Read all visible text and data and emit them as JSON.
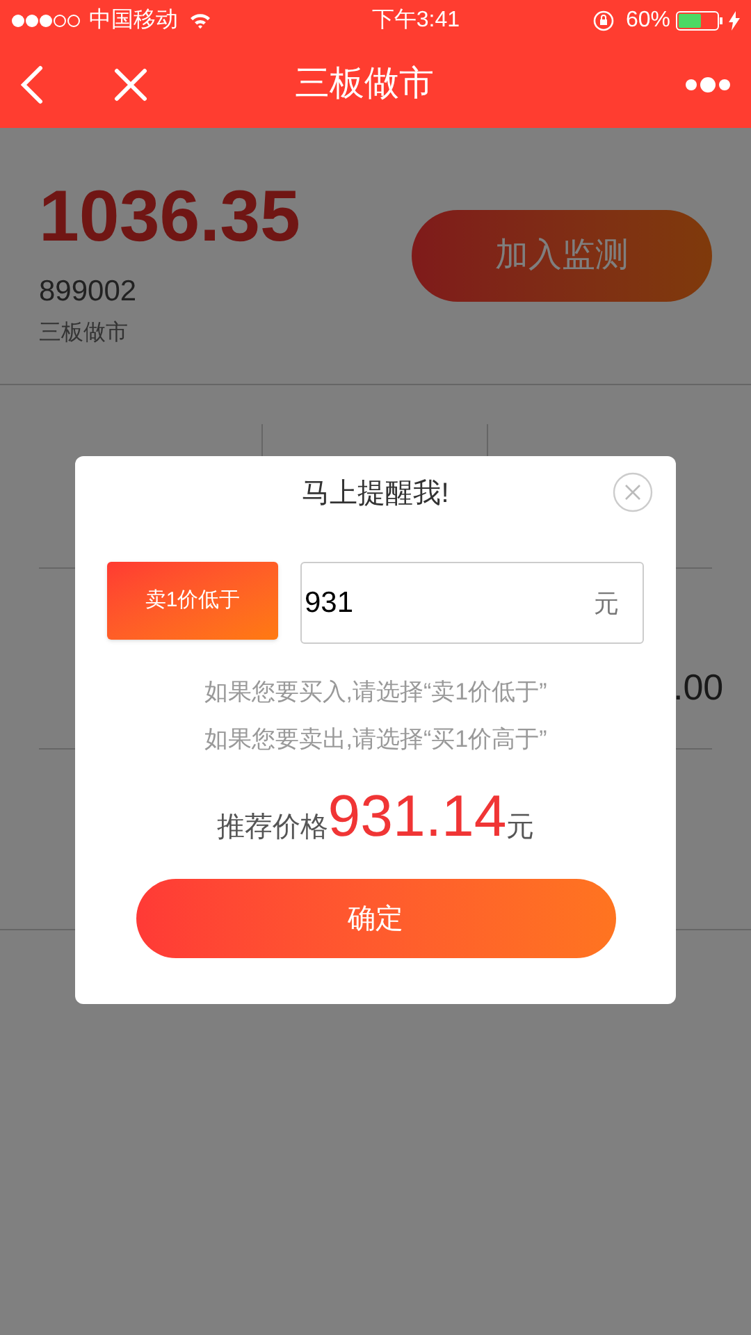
{
  "status_bar": {
    "carrier": "中国移动",
    "time": "下午3:41",
    "battery": "60%"
  },
  "nav": {
    "title": "三板做市"
  },
  "stock": {
    "price": "1036.35",
    "code": "899002",
    "market": "三板做市",
    "monitor_button": "加入监测"
  },
  "table": {
    "visible_cells": [
      ".00"
    ]
  },
  "dialog": {
    "title": "马上提醒我!",
    "condition_button": "卖1价低于",
    "input": {
      "value": "931",
      "unit": "元"
    },
    "hints": [
      "如果您要买入,请选择“卖1价低于”",
      "如果您要卖出,请选择“买1价高于”"
    ],
    "recommend": {
      "label": "推荐价格",
      "value": "931.14",
      "unit": "元"
    },
    "confirm_button": "确定"
  }
}
